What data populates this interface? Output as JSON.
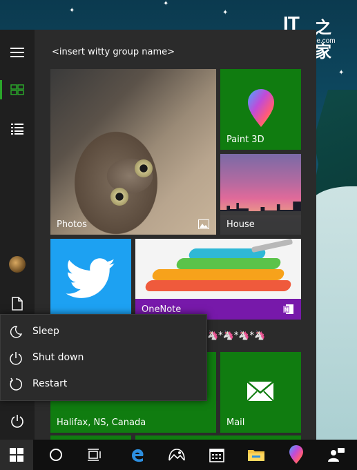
{
  "watermark": {
    "brand": "IT",
    "brand_zh": "之家",
    "url": "www.ithome.com"
  },
  "start_menu": {
    "group_name": "<insert witty group name>",
    "rail": {
      "hamburger_icon": "hamburger-icon",
      "tiles_icon": "tiles-icon",
      "list_icon": "all-apps-list-icon",
      "avatar_icon": "user-avatar",
      "documents_icon": "document-icon",
      "power_icon": "power-icon"
    },
    "tiles": {
      "photos": "Photos",
      "paint3d": "Paint 3D",
      "house": "House",
      "twitter": "Twitter",
      "onenote": "OneNote",
      "weather": "Halifax, NS, Canada",
      "mail": "Mail"
    },
    "group_fragment": "🦄*🦄*🦄*🦄"
  },
  "power_menu": {
    "items": [
      {
        "label": "Sleep",
        "icon": "moon-icon"
      },
      {
        "label": "Shut down",
        "icon": "power-icon"
      },
      {
        "label": "Restart",
        "icon": "restart-icon"
      }
    ]
  },
  "taskbar": {
    "items": [
      "start-windows-icon",
      "cortana-search-icon",
      "task-view-icon",
      "edge-icon",
      "photos-app-icon",
      "calendar-icon",
      "file-explorer-icon",
      "paint3d-icon",
      "people-icon"
    ]
  },
  "colors": {
    "tile_green": "#107c10",
    "twitter_blue": "#1da1f2",
    "onenote_purple": "#7719aa",
    "start_bg": "#2b2b2b",
    "rail_accent": "#2aa52a"
  }
}
